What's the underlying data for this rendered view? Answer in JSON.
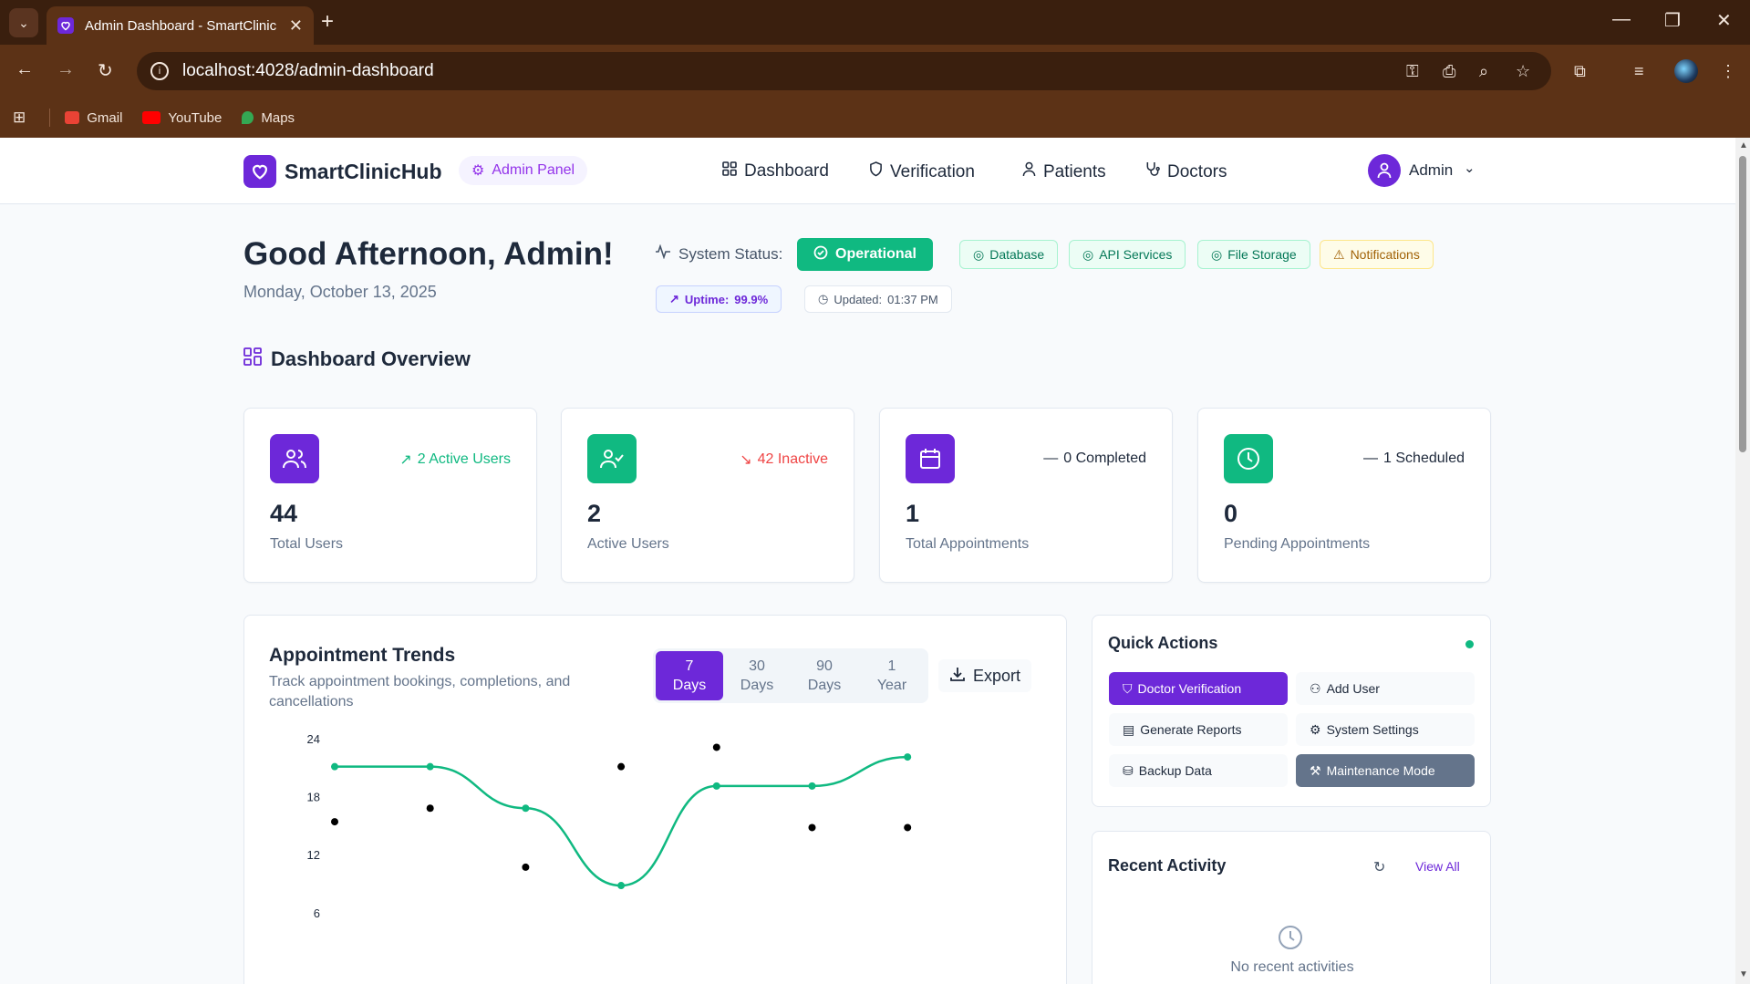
{
  "browser": {
    "tab_title": "Admin Dashboard - SmartClinic",
    "url": "localhost:4028/admin-dashboard",
    "bookmarks": [
      "Gmail",
      "YouTube",
      "Maps"
    ]
  },
  "header": {
    "brand": "SmartClinicHub",
    "badge": "Admin Panel",
    "nav": [
      "Dashboard",
      "Verification",
      "Patients",
      "Doctors"
    ],
    "user": "Admin"
  },
  "greeting": {
    "title": "Good Afternoon, Admin!",
    "date": "Monday, October 13, 2025"
  },
  "system": {
    "label": "System Status:",
    "status": "Operational",
    "services": [
      "Database",
      "API Services",
      "File Storage"
    ],
    "warning": "Notifications",
    "uptime_label": "Uptime:",
    "uptime_value": "99.9%",
    "updated_label": "Updated:",
    "updated_value": "01:37 PM"
  },
  "overview": {
    "title": "Dashboard Overview",
    "stats": [
      {
        "value": "44",
        "label": "Total Users",
        "trend": "2 Active Users",
        "color": "#6d28d9"
      },
      {
        "value": "2",
        "label": "Active Users",
        "trend": "42 Inactive",
        "color": "#10b981"
      },
      {
        "value": "1",
        "label": "Total Appointments",
        "trend": "0 Completed",
        "color": "#6d28d9"
      },
      {
        "value": "0",
        "label": "Pending Appointments",
        "trend": "1 Scheduled",
        "color": "#10b981"
      }
    ]
  },
  "trends": {
    "title": "Appointment Trends",
    "subtitle": "Track appointment bookings, completions, and cancellations",
    "ranges": [
      [
        "7",
        "Days"
      ],
      [
        "30",
        "Days"
      ],
      [
        "90",
        "Days"
      ],
      [
        "1",
        "Year"
      ]
    ],
    "export": "Export"
  },
  "chart_data": {
    "type": "line",
    "yticks": [
      24,
      18,
      12,
      6
    ],
    "ylim": [
      0,
      24
    ],
    "series": [
      {
        "values": [
          21.2,
          21.2,
          16.9,
          8.9,
          19.2,
          19.2,
          22.2
        ],
        "color": "#10b981"
      },
      {
        "values": [
          15.5,
          16.9,
          10.8,
          21.2,
          23.2,
          14.9,
          14.9
        ],
        "color": "#000000"
      }
    ]
  },
  "quick_actions": {
    "title": "Quick Actions",
    "items": [
      "Doctor Verification",
      "Add User",
      "Generate Reports",
      "System Settings",
      "Backup Data",
      "Maintenance Mode"
    ]
  },
  "recent_activity": {
    "title": "Recent Activity",
    "view_all": "View All",
    "empty": "No recent activities"
  }
}
